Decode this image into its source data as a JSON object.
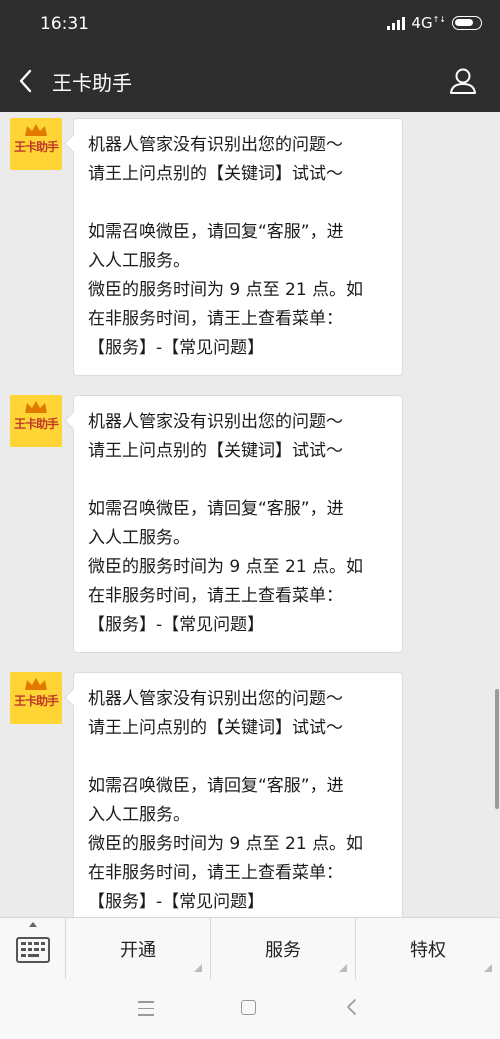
{
  "status_bar": {
    "time": "16:31",
    "network": "4G",
    "network_sub": "↑↓",
    "icons": [
      "signal-icon",
      "battery-icon"
    ]
  },
  "header": {
    "title": "王卡助手",
    "back_icon": "chevron-left-icon",
    "profile_icon": "user-icon"
  },
  "messages": [
    {
      "sender_avatar_text": "王卡助手",
      "lines": [
        "机器人管家没有识别出您的问题～",
        "请王上问点别的【关键词】试试～",
        "",
        "如需召唤微臣，请回复“客服”，进",
        "入人工服务。",
        "微臣的服务时间为 9 点至 21 点。如",
        "在非服务时间，请王上查看菜单：",
        "【服务】-【常见问题】"
      ]
    },
    {
      "sender_avatar_text": "王卡助手",
      "lines": [
        "机器人管家没有识别出您的问题～",
        "请王上问点别的【关键词】试试～",
        "",
        "如需召唤微臣，请回复“客服”，进",
        "入人工服务。",
        "微臣的服务时间为 9 点至 21 点。如",
        "在非服务时间，请王上查看菜单：",
        "【服务】-【常见问题】"
      ]
    },
    {
      "sender_avatar_text": "王卡助手",
      "lines": [
        "机器人管家没有识别出您的问题～",
        "请王上问点别的【关键词】试试～",
        "",
        "如需召唤微臣，请回复“客服”，进",
        "入人工服务。",
        "微臣的服务时间为 9 点至 21 点。如",
        "在非服务时间，请王上查看菜单：",
        "【服务】-【常见问题】"
      ]
    }
  ],
  "menu": {
    "keyboard_icon": "keyboard-icon",
    "items": [
      {
        "label": "开通"
      },
      {
        "label": "服务"
      },
      {
        "label": "特权"
      }
    ]
  },
  "nav": {
    "icons": [
      "menu-icon",
      "home-icon",
      "back-icon"
    ]
  },
  "colors": {
    "header_bg": "#2e2e2e",
    "chat_bg": "#ebebeb",
    "bubble_bg": "#ffffff",
    "avatar_bg": "#ffd535",
    "avatar_text": "#c0392b"
  }
}
